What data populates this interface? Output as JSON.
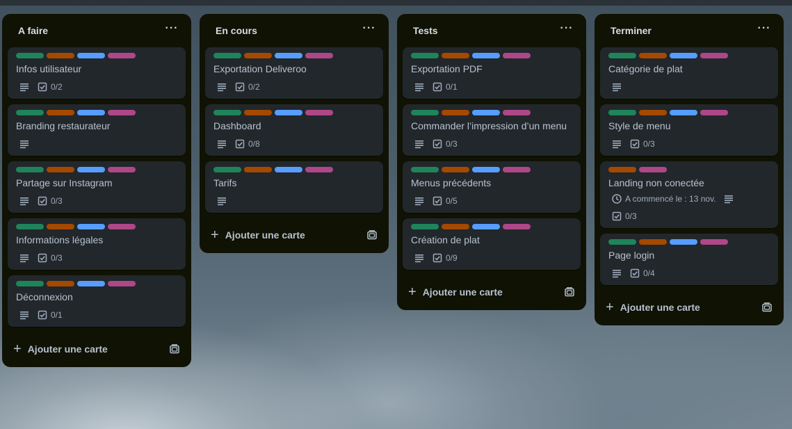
{
  "colors": {
    "green": "#1f845a",
    "orange": "#a54800",
    "blue": "#579dff",
    "purple": "#ae4787"
  },
  "icons": {
    "description": "description-icon",
    "checklist": "checklist-icon",
    "clock": "clock-icon",
    "template": "card-template-icon",
    "menu": "list-menu-icon",
    "plus": "plus-icon"
  },
  "add_card_label": "Ajouter une carte",
  "lists": [
    {
      "title": "A faire",
      "menu": "···",
      "cards": [
        {
          "title": "Infos utilisateur",
          "labels": [
            "green",
            "orange",
            "blue",
            "purple"
          ],
          "description": true,
          "checklist": "0/2"
        },
        {
          "title": "Branding restaurateur",
          "labels": [
            "green",
            "orange",
            "blue",
            "purple"
          ],
          "description": true,
          "checklist": ""
        },
        {
          "title": "Partage sur Instagram",
          "labels": [
            "green",
            "orange",
            "blue",
            "purple"
          ],
          "description": true,
          "checklist": "0/3"
        },
        {
          "title": "Informations légales",
          "labels": [
            "green",
            "orange",
            "blue",
            "purple"
          ],
          "description": true,
          "checklist": "0/3"
        },
        {
          "title": "Déconnexion",
          "labels": [
            "green",
            "orange",
            "blue",
            "purple"
          ],
          "description": true,
          "checklist": "0/1"
        }
      ]
    },
    {
      "title": "En cours",
      "menu": "···",
      "cards": [
        {
          "title": "Exportation Deliveroo",
          "labels": [
            "green",
            "orange",
            "blue",
            "purple"
          ],
          "description": true,
          "checklist": "0/2"
        },
        {
          "title": "Dashboard",
          "labels": [
            "green",
            "orange",
            "blue",
            "purple"
          ],
          "description": true,
          "checklist": "0/8"
        },
        {
          "title": "Tarifs",
          "labels": [
            "green",
            "orange",
            "blue",
            "purple"
          ],
          "description": true,
          "checklist": ""
        }
      ]
    },
    {
      "title": "Tests",
      "menu": "···",
      "cards": [
        {
          "title": "Exportation PDF",
          "labels": [
            "green",
            "orange",
            "blue",
            "purple"
          ],
          "description": true,
          "checklist": "0/1"
        },
        {
          "title": "Commander l’impression d’un menu",
          "labels": [
            "green",
            "orange",
            "blue",
            "purple"
          ],
          "description": true,
          "checklist": "0/3"
        },
        {
          "title": "Menus précédents",
          "labels": [
            "green",
            "orange",
            "blue",
            "purple"
          ],
          "description": true,
          "checklist": "0/5"
        },
        {
          "title": "Création de plat",
          "labels": [
            "green",
            "orange",
            "blue",
            "purple"
          ],
          "description": true,
          "checklist": "0/9"
        }
      ]
    },
    {
      "title": "Terminer",
      "menu": "···",
      "cards": [
        {
          "title": "Catégorie de plat",
          "labels": [
            "green",
            "orange",
            "blue",
            "purple"
          ],
          "description": true,
          "checklist": ""
        },
        {
          "title": "Style de menu",
          "labels": [
            "green",
            "orange",
            "blue",
            "purple"
          ],
          "description": true,
          "checklist": "0/3"
        },
        {
          "title": "Landing non conectée",
          "labels": [
            "orange",
            "purple"
          ],
          "start_date": "A commencé le : 13 nov.",
          "description": true,
          "checklist": "0/3"
        },
        {
          "title": "Page login",
          "labels": [
            "green",
            "orange",
            "blue",
            "purple"
          ],
          "description": true,
          "checklist": "0/4"
        }
      ]
    }
  ]
}
